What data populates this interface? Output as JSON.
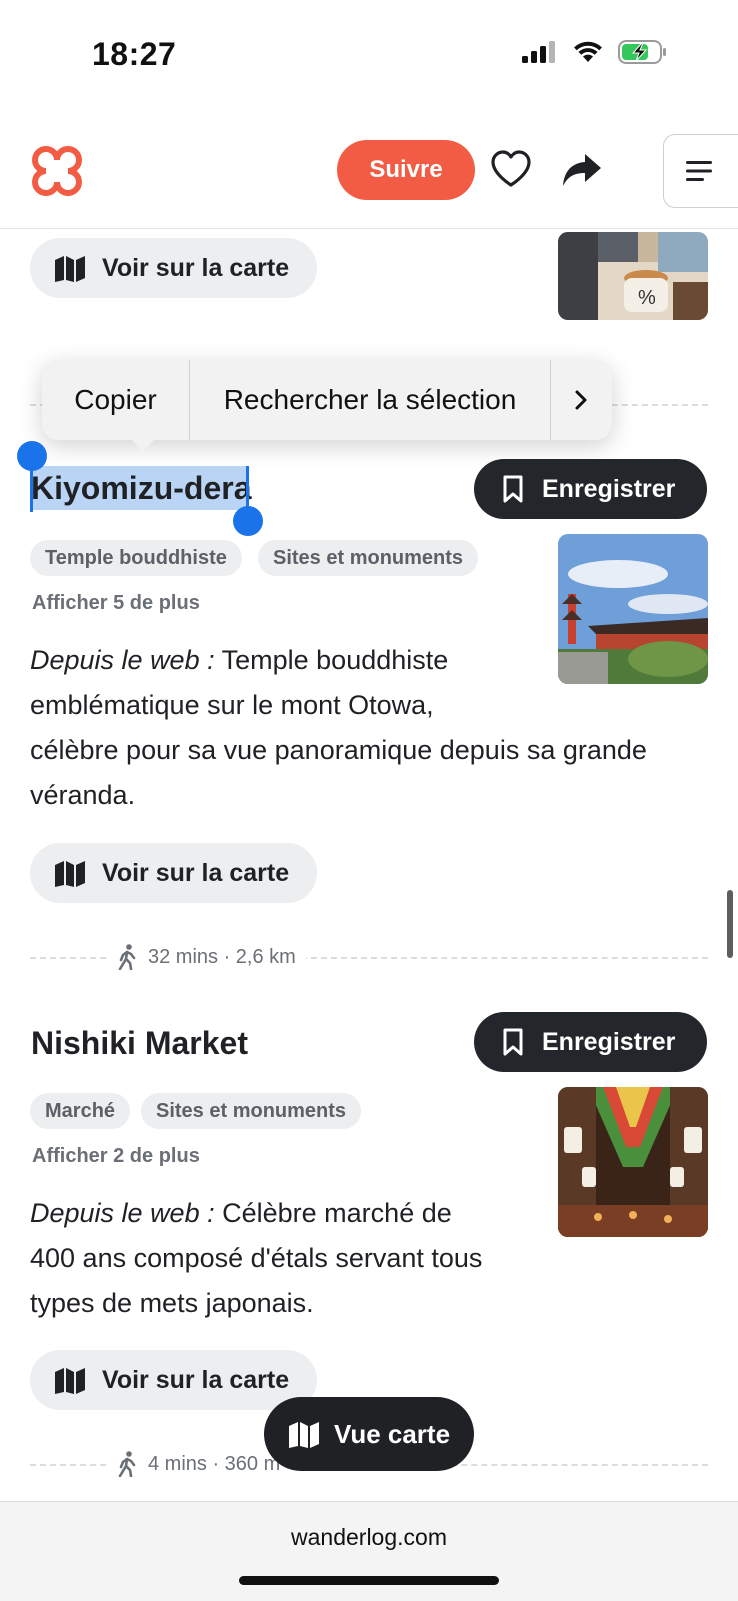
{
  "status": {
    "time": "18:27"
  },
  "header": {
    "follow_label": "Suivre"
  },
  "context_menu": {
    "copy": "Copier",
    "search": "Rechercher la sélection"
  },
  "top_item": {
    "map_label": "Voir sur la carte"
  },
  "places": [
    {
      "title": "Kiyomizu-dera",
      "save_label": "Enregistrer",
      "tags": [
        "Temple bouddhiste",
        "Sites et monuments"
      ],
      "more": "Afficher 5 de plus",
      "desc_prefix": "Depuis le web :",
      "desc_lines": [
        "Temple bouddhiste",
        "emblématique sur le mont Otowa,",
        "célèbre pour sa vue panoramique depuis sa grande",
        "véranda."
      ],
      "map_label": "Voir sur la carte",
      "walk": "32 mins · 2,6 km"
    },
    {
      "title": "Nishiki Market",
      "save_label": "Enregistrer",
      "tags": [
        "Marché",
        "Sites et monuments"
      ],
      "more": "Afficher 2 de plus",
      "desc_prefix": "Depuis le web :",
      "desc_lines": [
        "Célèbre marché de",
        "400 ans composé d'étals servant tous",
        "types de mets japonais."
      ],
      "map_label": "Voir sur la carte",
      "walk": "4 mins · 360 m"
    }
  ],
  "fab": {
    "label": "Vue carte"
  },
  "browser": {
    "url": "wanderlog.com"
  },
  "colors": {
    "accent": "#f25c44",
    "dark": "#23262b",
    "selection": "#b9d4f5",
    "handle": "#1a73e8"
  }
}
